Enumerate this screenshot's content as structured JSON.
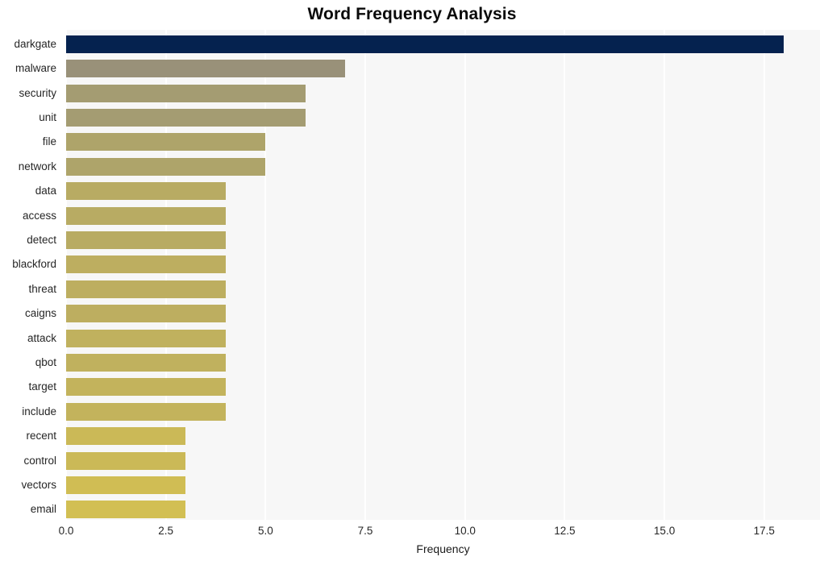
{
  "chart_data": {
    "type": "bar",
    "orientation": "horizontal",
    "title": "Word Frequency Analysis",
    "xlabel": "Frequency",
    "ylabel": "",
    "categories": [
      "darkgate",
      "malware",
      "security",
      "unit",
      "file",
      "network",
      "data",
      "access",
      "detect",
      "blackford",
      "threat",
      "caigns",
      "attack",
      "qbot",
      "target",
      "include",
      "recent",
      "control",
      "vectors",
      "email"
    ],
    "values": [
      18,
      7,
      6,
      6,
      5,
      5,
      4,
      4,
      4,
      4,
      4,
      4,
      4,
      4,
      4,
      4,
      3,
      3,
      3,
      3
    ],
    "bar_colors": [
      "#05224f",
      "#999179",
      "#a49c72",
      "#a49c72",
      "#aea46a",
      "#aea46a",
      "#b8ab63",
      "#b8ab63",
      "#b8ab63",
      "#bdae60",
      "#bdae60",
      "#bdae60",
      "#c0b15e",
      "#c0b15e",
      "#c3b35c",
      "#c3b35c",
      "#cbb957",
      "#cbb957",
      "#d0bd54",
      "#d2bf53"
    ],
    "xticks": [
      "0.0",
      "2.5",
      "5.0",
      "7.5",
      "10.0",
      "12.5",
      "15.0",
      "17.5"
    ],
    "xtick_values": [
      0,
      2.5,
      5,
      7.5,
      10,
      12.5,
      15,
      17.5
    ],
    "xlim": [
      0,
      18.9
    ],
    "grid": true,
    "legend": false,
    "plot_background": "#f7f7f7",
    "gridline_color": "#ffffff",
    "figure_background": "#ffffff",
    "title_color": "#0a0a0a",
    "tick_label_color": "#262626"
  }
}
